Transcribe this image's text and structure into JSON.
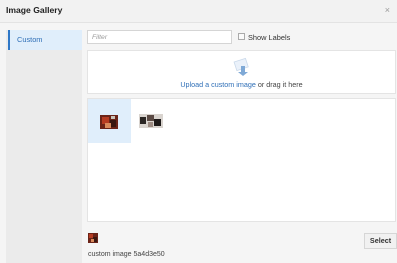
{
  "dialog": {
    "title": "Image Gallery",
    "close_glyph": "×"
  },
  "sidebar": {
    "items": [
      {
        "label": "Custom",
        "selected": true
      }
    ]
  },
  "filter": {
    "placeholder": "Filter",
    "value": ""
  },
  "show_labels": {
    "label": "Show Labels",
    "checked": false
  },
  "upload": {
    "link_text": "Upload a custom image",
    "rest_text": " or drag it here",
    "icon": "upload-arrow-icon"
  },
  "gallery": {
    "thumbnails": [
      {
        "icon": "custom-image-thumbnail",
        "selected": true
      },
      {
        "icon": "custom-image-thumbnail-2",
        "selected": false
      }
    ]
  },
  "selection": {
    "name": "custom image 5a4d3e50"
  },
  "buttons": {
    "select_label": "Select"
  },
  "colors": {
    "accent": "#2f77c7",
    "link": "#2f6fb7",
    "selected_bg": "#e0eefb"
  }
}
